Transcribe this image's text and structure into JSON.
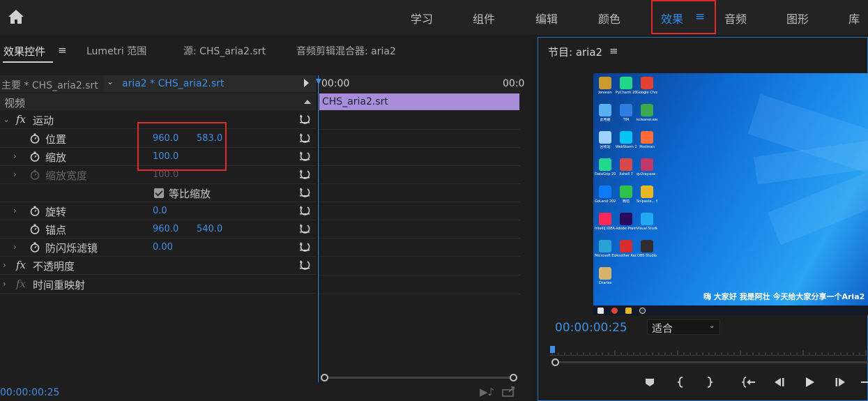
{
  "workspaces": [
    {
      "label": "学习",
      "active": false
    },
    {
      "label": "组件",
      "active": false
    },
    {
      "label": "编辑",
      "active": false
    },
    {
      "label": "颜色",
      "active": false
    },
    {
      "label": "效果",
      "active": true
    },
    {
      "label": "音频",
      "active": false
    },
    {
      "label": "图形",
      "active": false
    },
    {
      "label": "库",
      "active": false
    }
  ],
  "workspace_menu_glyph": "≡",
  "left_panel": {
    "tabs": [
      "效果控件",
      "Lumetri 范围",
      "源: CHS_aria2.srt",
      "音频剪辑混合器: aria2"
    ],
    "tab_menu_glyph": "≡",
    "clip_header": {
      "master": "主要 * CHS_aria2.srt",
      "sequence": "aria2 * CHS_aria2.srt"
    },
    "video_label": "视频",
    "effects": {
      "motion": "运动",
      "position": {
        "label": "位置",
        "x": "960.0",
        "y": "583.0"
      },
      "scale": {
        "label": "缩放",
        "value": "100.0"
      },
      "scale_width": {
        "label": "缩放宽度",
        "value": "100.0"
      },
      "uniform_scale": {
        "label": "等比缩放",
        "checked": true
      },
      "rotation": {
        "label": "旋转",
        "value": "0.0"
      },
      "anchor": {
        "label": "锚点",
        "x": "960.0",
        "y": "540.0"
      },
      "anti_flicker": {
        "label": "防闪烁滤镜",
        "value": "0.00"
      },
      "opacity": "不透明度",
      "time_remap": "时间重映射"
    },
    "fx_glyph": "fx",
    "timeline": {
      "start_time": "00:00",
      "end_time": "00:0",
      "clip_label": "CHS_aria2.srt",
      "clip_color": "#a88ddb"
    },
    "current_time": "00:00:00:25"
  },
  "program_monitor": {
    "title": "节目: aria2",
    "menu_glyph": "≡",
    "timecode": "00:00:00:25",
    "fit": "适合",
    "subtitle": "嗨 大家好 我是阿壮 今天给大家分享一个Aria2",
    "desktop_icons": [
      {
        "caption": "Jonassn",
        "color": "#c99a2e"
      },
      {
        "caption": "PyCharm 2020.3...",
        "color": "#21d789"
      },
      {
        "caption": "Google Chrome",
        "color": "#e34133"
      },
      {
        "caption": "此电脑",
        "color": "#5ab0f0"
      },
      {
        "caption": "TIM",
        "color": "#2f7de1"
      },
      {
        "caption": "kcleaner.exe - 快捷方式",
        "color": "#3ba84b"
      },
      {
        "caption": "回收站",
        "color": "#9fd3ff"
      },
      {
        "caption": "WebStorm 2020.3...",
        "color": "#07c3f2"
      },
      {
        "caption": "Postman",
        "color": "#ff6c37"
      },
      {
        "caption": "DataGrip 2020.3...",
        "color": "#22d88f"
      },
      {
        "caption": "Xshell 7",
        "color": "#d84a4a"
      },
      {
        "caption": "qv2ray.exe - 快捷方式",
        "color": "#c0376a"
      },
      {
        "caption": "GoLand 2020.3...",
        "color": "#0d7bf7"
      },
      {
        "caption": "微信",
        "color": "#2ec24a"
      },
      {
        "caption": "Snipaste... 快捷方式",
        "color": "#e7b923"
      },
      {
        "caption": "IntelliJ IDEA 2020.3.4...",
        "color": "#fe2857"
      },
      {
        "caption": "Adobe Premie...",
        "color": "#2a0a5e"
      },
      {
        "caption": "Visual Studio Code",
        "color": "#23a8f2"
      },
      {
        "caption": "Microsoft Edge",
        "color": "#29a3d6"
      },
      {
        "caption": "Another Redis...",
        "color": "#d62d2d"
      },
      {
        "caption": "OBS Studio",
        "color": "#302e31"
      },
      {
        "caption": "Charles",
        "color": "#d9b36c"
      }
    ]
  },
  "colors": {
    "accent": "#2d8ceb",
    "highlight_box": "#e12b2b",
    "value_blue": "#3f8fe6"
  }
}
